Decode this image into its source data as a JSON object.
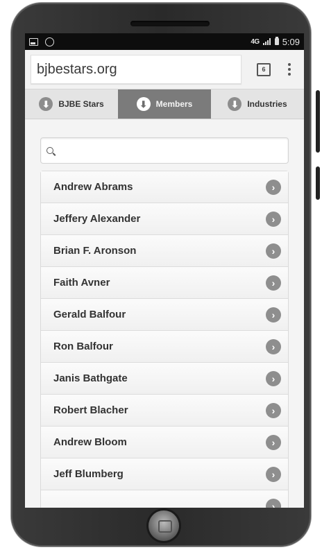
{
  "status": {
    "network": "4G",
    "time": "5:09"
  },
  "browser": {
    "url": "bjbestars.org",
    "tab_count": "6"
  },
  "nav": {
    "items": [
      {
        "label": "BJBE Stars",
        "icon": "arrow-down-circle-icon",
        "active": false
      },
      {
        "label": "Members",
        "icon": "arrow-down-circle-icon",
        "active": true
      },
      {
        "label": "Industries",
        "icon": "arrow-down-circle-icon",
        "active": false
      }
    ]
  },
  "search": {
    "placeholder": "",
    "value": ""
  },
  "members": [
    "Andrew Abrams",
    "Jeffery Alexander",
    "Brian F. Aronson",
    "Faith Avner",
    "Gerald Balfour",
    "Ron Balfour",
    "Janis Bathgate",
    "Robert Blacher",
    "Andrew Bloom",
    "Jeff Blumberg"
  ],
  "colors": {
    "active_tab": "#7b7b7b",
    "chevron": "#8e8e8e",
    "status_bar": "#0d0d0d"
  }
}
